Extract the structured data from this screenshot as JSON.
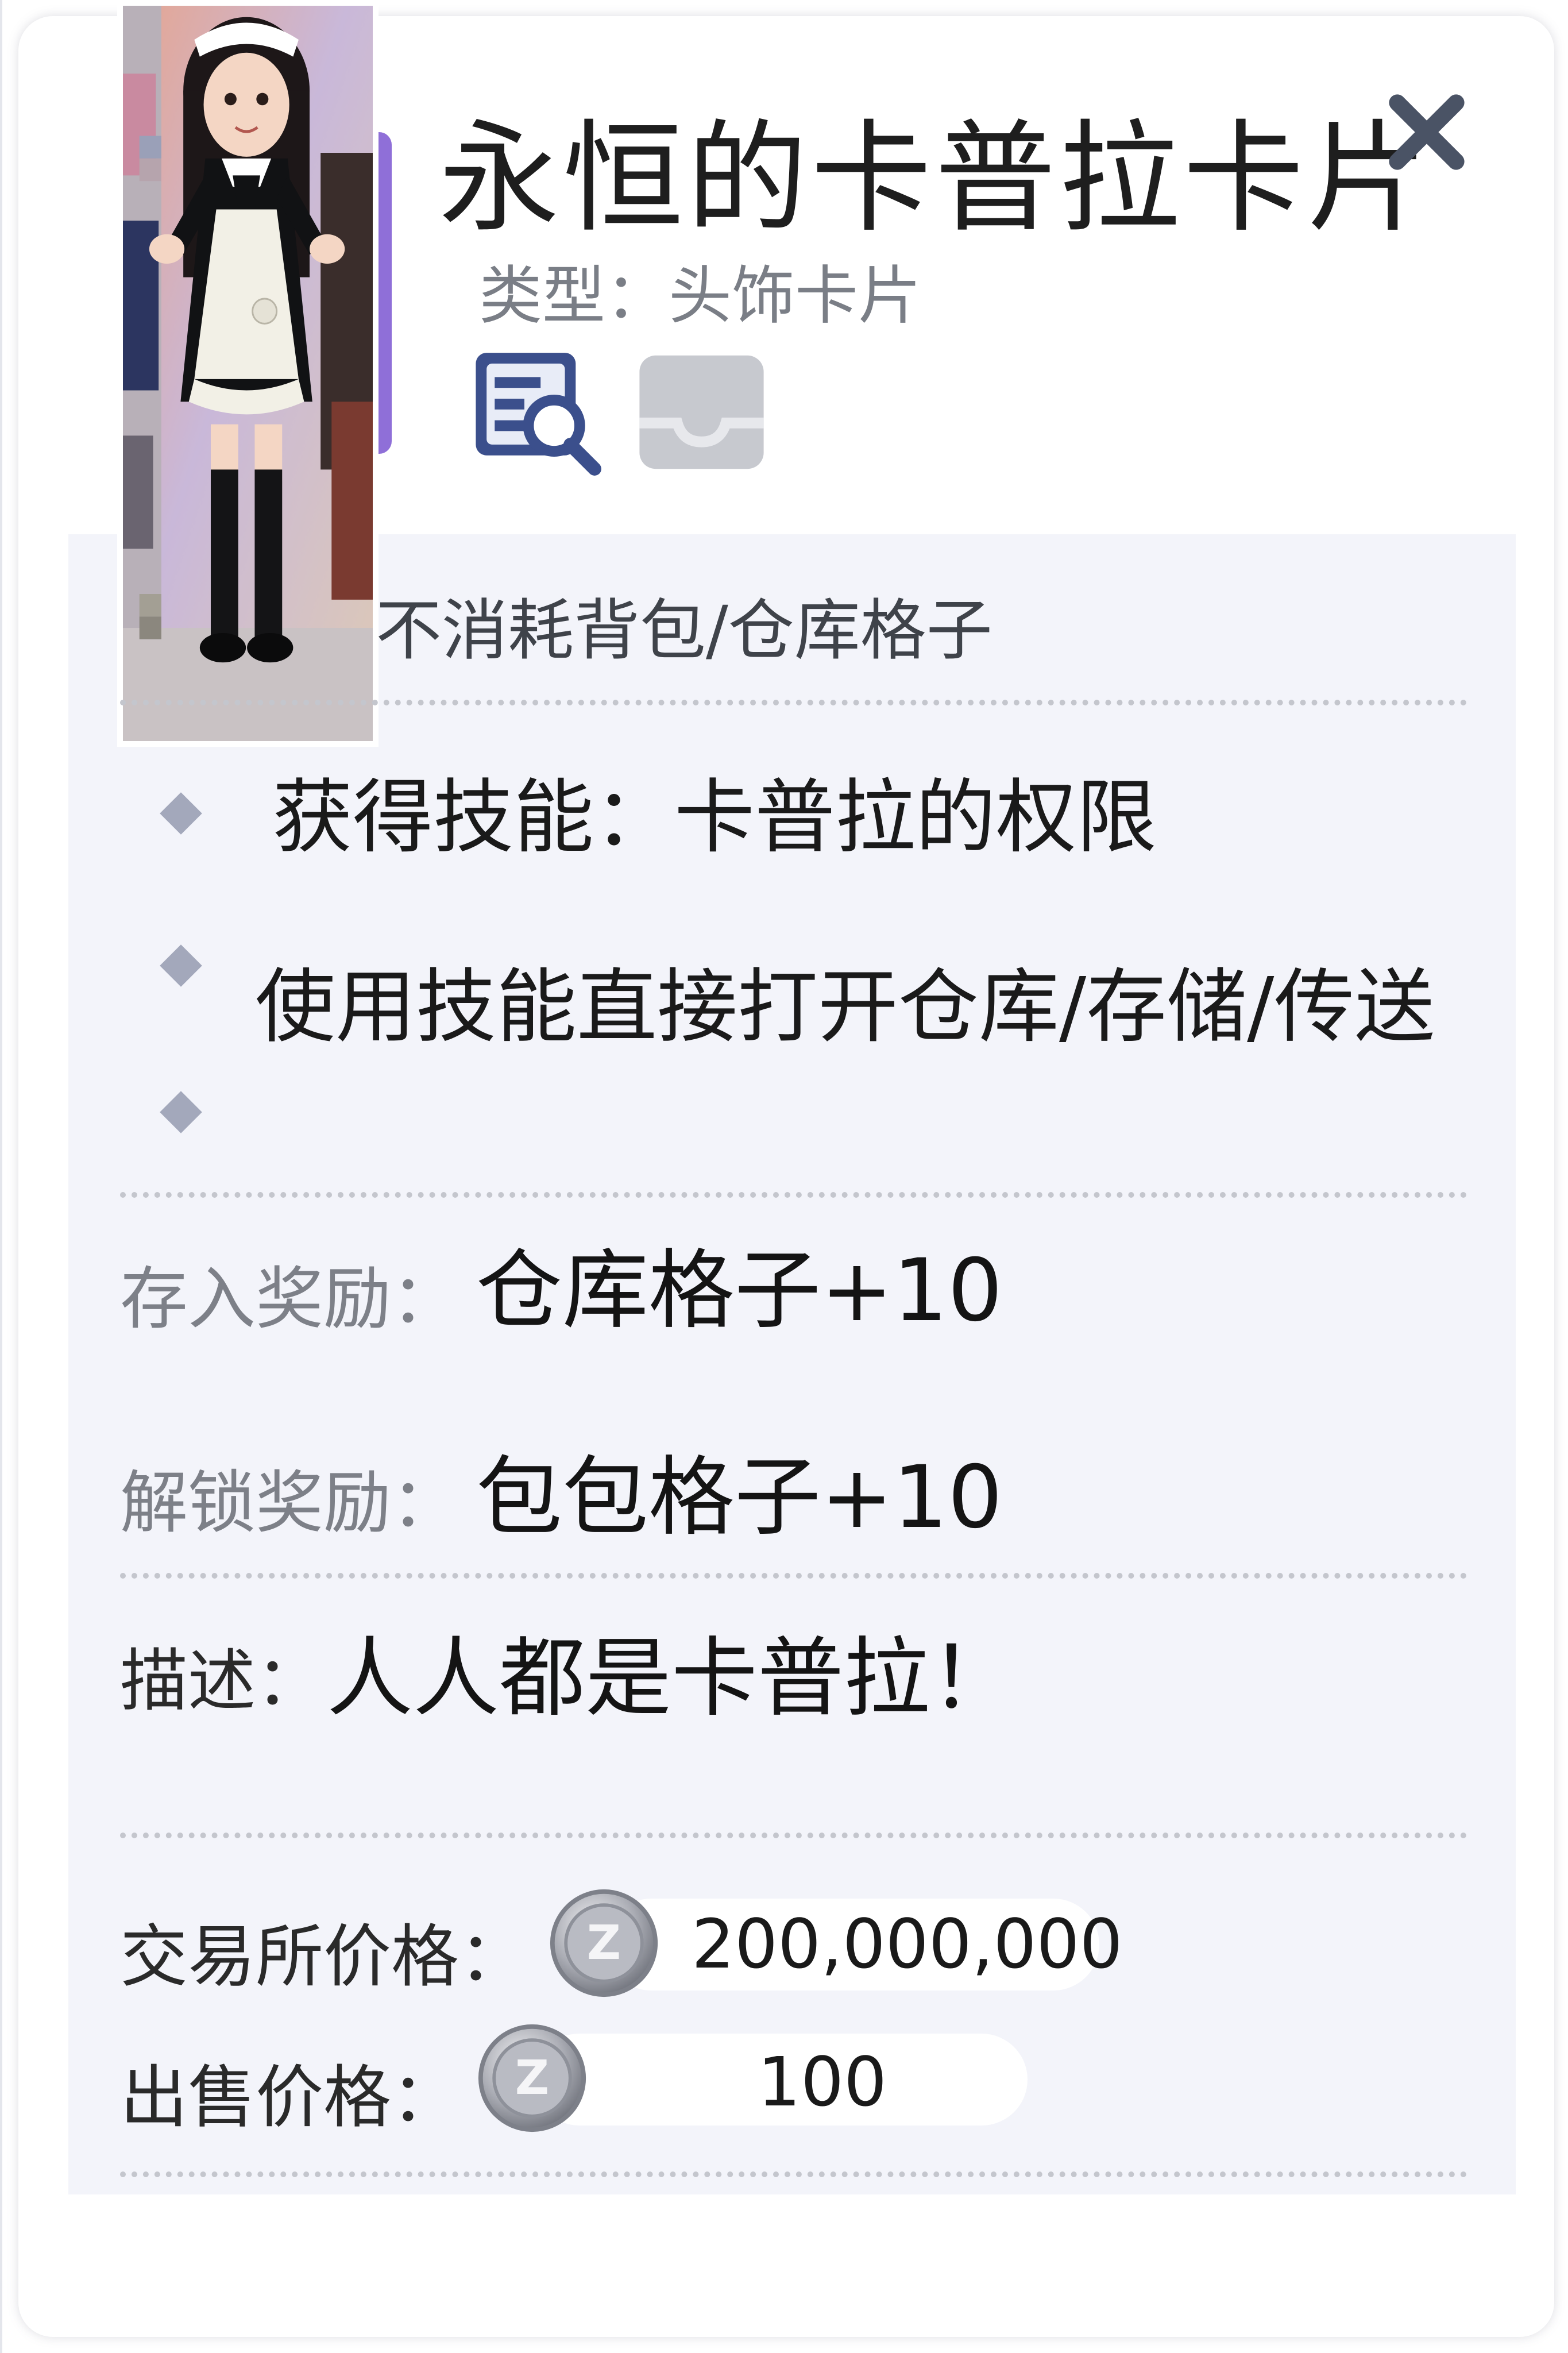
{
  "header": {
    "title": "永恒的卡普拉卡片",
    "type_line": "类型：头饰卡片"
  },
  "effects": {
    "partial_line": "不消耗背包/仓库格子",
    "items": [
      "获得技能：卡普拉的权限",
      "使用技能直接打开仓库/存储/传送",
      ""
    ]
  },
  "rewards": {
    "deposit_label": "存入奖励：",
    "deposit_value": "仓库格子+10",
    "unlock_label": "解锁奖励：",
    "unlock_value": "包包格子+10"
  },
  "description": {
    "label": "描述：",
    "text": "人人都是卡普拉！"
  },
  "prices": {
    "exchange_label": "交易所价格：",
    "exchange_value": "200,000,000",
    "sell_label": "出售价格：",
    "sell_value": "100",
    "coin_symbol": "Z"
  },
  "colors": {
    "panel_bg": "#ffffff",
    "content_bg": "#f3f4fa",
    "icon_blue": "#3b4f8c",
    "icon_gray": "#c7c9cf",
    "bullet": "#a3a8bb"
  },
  "icons": {
    "close": "close-icon",
    "inspect": "document-search-icon",
    "storage": "tray-icon",
    "coin": "zeny-coin-icon"
  }
}
